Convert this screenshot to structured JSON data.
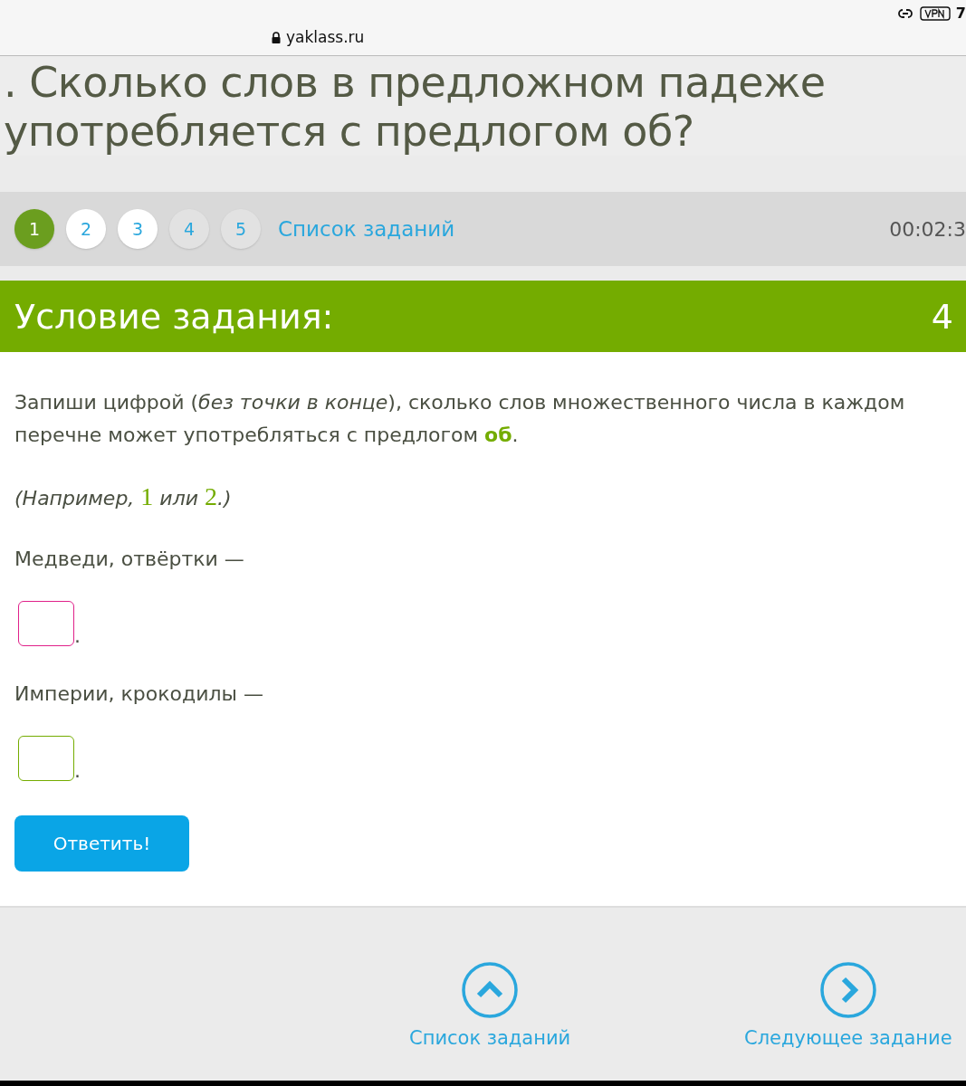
{
  "browser": {
    "address": "yaklass.ru",
    "battery": "7"
  },
  "title_lines": [
    ". Сколько слов в предложном падеже",
    "употребляется с предлогом об?"
  ],
  "task_nav": {
    "tasks": [
      {
        "label": "1",
        "selected": true
      },
      {
        "label": "2",
        "selected": false,
        "visited": true
      },
      {
        "label": "3",
        "selected": false,
        "visited": true
      },
      {
        "label": "4",
        "selected": false,
        "visited": false
      },
      {
        "label": "5",
        "selected": false,
        "visited": false
      }
    ],
    "list_link": "Список заданий",
    "timer": "00:02:3"
  },
  "condition": {
    "heading": "Условие задания:",
    "points": "4"
  },
  "instruction": "Запиши цифрой (*без точки в конце*), сколько слов множественного числа в каждом перечне может употребляться с предлогом **об**.",
  "example": "(Например, 1 или 2.)",
  "questions": [
    {
      "prompt": "Медведи, отвёртки —",
      "suffix": ".",
      "color": "#e0218a"
    },
    {
      "prompt": "Империи, крокодилы —",
      "suffix": ".",
      "color": "#74ac00"
    }
  ],
  "submit": "Ответить!",
  "footer": {
    "list_link": "Список заданий",
    "next_link": "Следующее задание"
  }
}
